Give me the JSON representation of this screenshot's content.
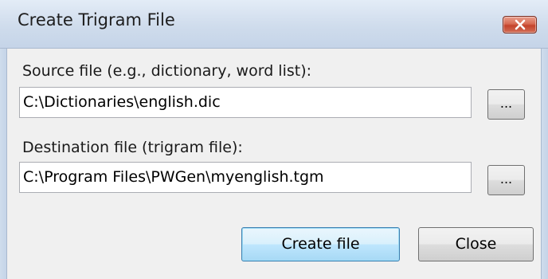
{
  "window": {
    "title": "Create Trigram File"
  },
  "source": {
    "label": "Source file (e.g., dictionary, word list):",
    "value": "C:\\Dictionaries\\english.dic",
    "browse_label": "..."
  },
  "destination": {
    "label": "Destination file (trigram file):",
    "value": "C:\\Program Files\\PWGen\\myenglish.tgm",
    "browse_label": "..."
  },
  "buttons": {
    "create_label": "Create file",
    "close_label": "Close"
  },
  "icons": {
    "close": "close-icon"
  },
  "colors": {
    "close_button": "#c4432b",
    "default_button_border": "#3c7fb1",
    "titlebar": "#cfdcec"
  }
}
